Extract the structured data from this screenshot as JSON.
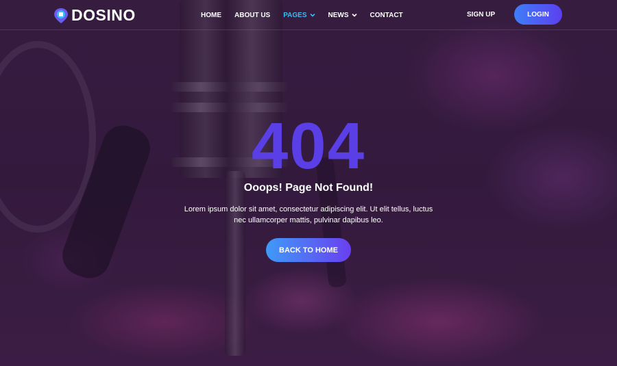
{
  "brand": {
    "name": "DOSINO",
    "icon": "map-pin-robot-icon"
  },
  "nav": {
    "items": [
      {
        "label": "HOME",
        "active": false,
        "has_dropdown": false
      },
      {
        "label": "ABOUT US",
        "active": false,
        "has_dropdown": false
      },
      {
        "label": "PAGES",
        "active": true,
        "has_dropdown": true
      },
      {
        "label": "NEWS",
        "active": false,
        "has_dropdown": true
      },
      {
        "label": "CONTACT",
        "active": false,
        "has_dropdown": false
      }
    ],
    "signup_label": "SIGN UP",
    "login_label": "LOGIN"
  },
  "error": {
    "code": "404",
    "headline": "Ooops! Page Not Found!",
    "description": "Lorem ipsum dolor sit amet, consectetur adipiscing elit. Ut elit tellus, luctus nec ullamcorper mattis, pulvinar dapibus leo.",
    "back_label": "BACK TO HOME"
  },
  "colors": {
    "accent_code": "#5a3ee6",
    "nav_active": "#3bbcf0",
    "button_gradient_start": "#3f7ef7",
    "button_gradient_end": "#5b3ff0"
  }
}
